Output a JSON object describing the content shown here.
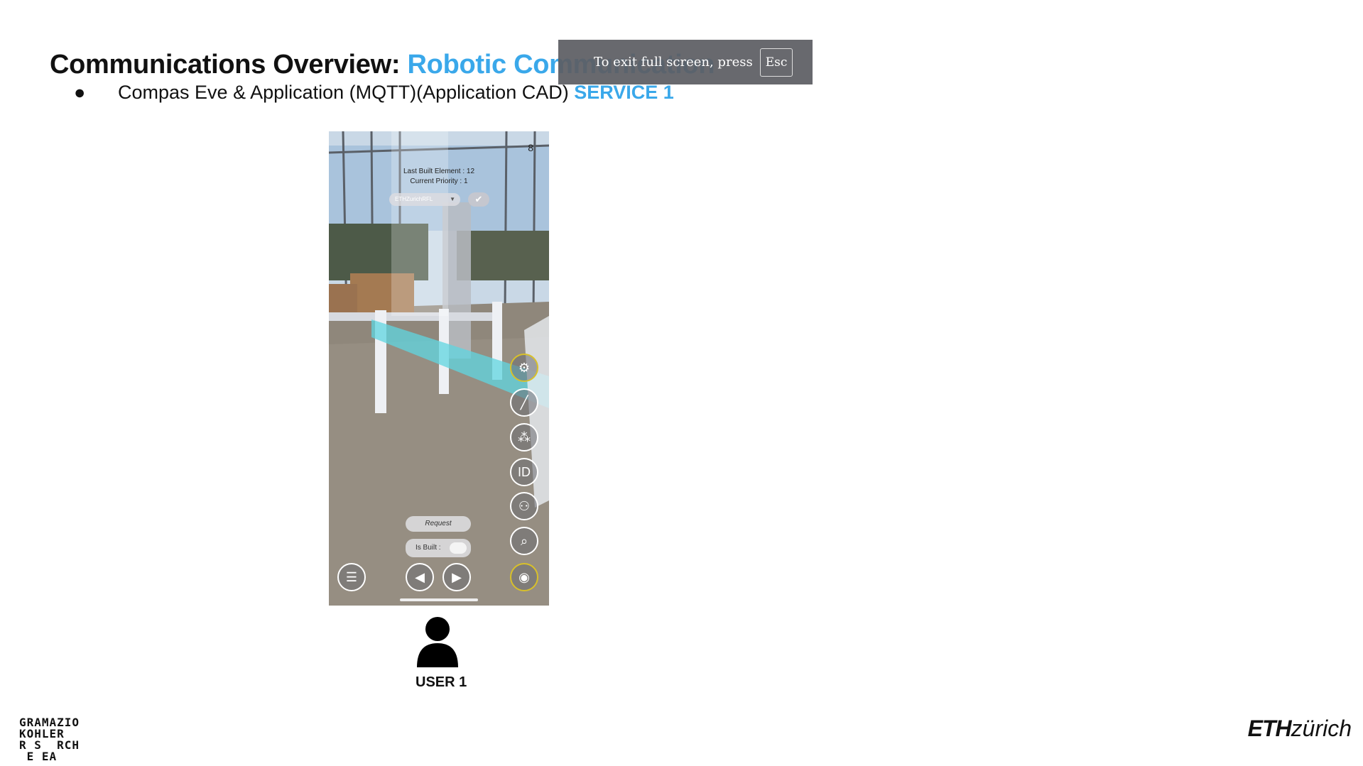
{
  "slide": {
    "title_prefix": "Communications Overview: ",
    "title_accent": "Robotic Communication",
    "bullet_glyph": "●",
    "bullet_text": "Compas Eve & Application (MQTT)(Application CAD) ",
    "bullet_service": "SERVICE 1",
    "user_label": "USER 1",
    "accent_color": "#3aa8ea"
  },
  "fullscreen_notice": {
    "text": "To exit full screen, press",
    "key": "Esc"
  },
  "phone_app": {
    "counter": "8",
    "last_built": "Last Built Element : 12",
    "current_priority": "Current Priority : 1",
    "dropdown_value": "ETHZurichRFL",
    "request_button": "Request",
    "is_built_label": "Is Built :",
    "id_button": "ID",
    "tool_icons": [
      "robot-icon",
      "pencil-icon",
      "network-icon",
      "id-icon",
      "users-icon",
      "search-icon",
      "eye-icon"
    ],
    "nav_icons": [
      "menu-icon",
      "previous-icon",
      "next-icon"
    ]
  },
  "logos": {
    "left_lines": [
      "GRAMAZIO",
      "KOHLER",
      "R S  RCH",
      " E EA"
    ],
    "right_eth": "ETH",
    "right_zurich": "zürich"
  }
}
